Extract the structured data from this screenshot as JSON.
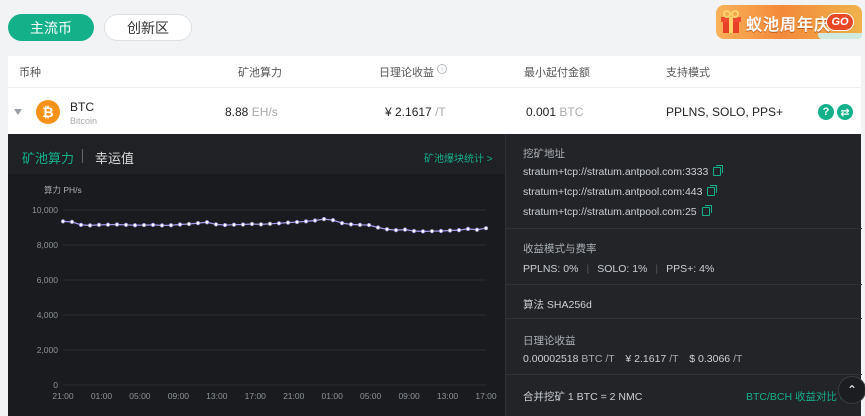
{
  "tabs": [
    {
      "label": "主流币",
      "active": true
    },
    {
      "label": "创新区",
      "active": false
    }
  ],
  "banner": {
    "text": "蚁池周年庆",
    "go": "GO"
  },
  "table": {
    "headers": {
      "coin": "币种",
      "hashrate": "矿池算力",
      "daily_revenue": "日理论收益",
      "min_payout": "最小起付金额",
      "modes": "支持模式"
    },
    "row": {
      "coin": "BTC",
      "coin_sub": "Bitcoin",
      "hashrate_value": "8.88",
      "hashrate_unit": "EH/s",
      "revenue_value": "¥ 2.1617",
      "revenue_unit": "/T",
      "min_value": "0.001",
      "min_unit": "BTC",
      "modes": "PPLNS, SOLO, PPS+"
    }
  },
  "panel": {
    "tab_hashrate": "矿池算力",
    "tab_luck": "幸运值",
    "block_stats_link": "矿池爆块统计 >",
    "mining_address_label": "挖矿地址",
    "addresses": [
      "stratum+tcp://stratum.antpool.com:3333",
      "stratum+tcp://stratum.antpool.com:443",
      "stratum+tcp://stratum.antpool.com:25"
    ],
    "fee_label": "收益模式与费率",
    "fees": [
      "PPLNS: 0%",
      "SOLO: 1%",
      "PPS+: 4%"
    ],
    "algorithm": "算法 SHA256d",
    "daily_label": "日理论收益",
    "daily_btc": "0.00002518",
    "daily_btc_unit": "BTC /T",
    "daily_cny": "¥ 2.1617",
    "daily_cny_unit": "/T",
    "daily_usd": "$ 0.3066",
    "daily_usd_unit": "/T",
    "merged_mining": "合并挖矿 1 BTC = 2 NMC",
    "compare_link": "BTC/BCH 收益对比 >"
  },
  "colors": {
    "accent": "#14b08a",
    "btc": "#f7931a",
    "line": "#a99bf2"
  },
  "icons": [
    "caret-down-icon",
    "bitcoin-icon",
    "help-icon",
    "switch-icon",
    "copy-icon",
    "info-icon",
    "chevron-up-icon"
  ],
  "chart_data": {
    "type": "line",
    "ylabel": "算力 PH/s",
    "ylim": [
      0,
      10000
    ],
    "yticks": [
      "10,000",
      "8,000",
      "6,000",
      "4,000",
      "2,000",
      "0"
    ],
    "xticks": [
      "21:00",
      "01:00",
      "05:00",
      "09:00",
      "13:00",
      "17:00",
      "21:00",
      "01:00",
      "05:00",
      "09:00",
      "13:00",
      "17:00"
    ],
    "series": [
      {
        "values": [
          9350,
          9320,
          9150,
          9120,
          9150,
          9160,
          9170,
          9150,
          9130,
          9140,
          9150,
          9120,
          9130,
          9170,
          9200,
          9250,
          9300,
          9180,
          9140,
          9160,
          9170,
          9200,
          9180,
          9210,
          9240,
          9280,
          9310,
          9350,
          9400,
          9480,
          9420,
          9250,
          9180,
          9150,
          9140,
          9000,
          8900,
          8850,
          8880,
          8800,
          8780,
          8790,
          8800,
          8830,
          8850,
          8920,
          8870,
          8960
        ]
      }
    ]
  }
}
